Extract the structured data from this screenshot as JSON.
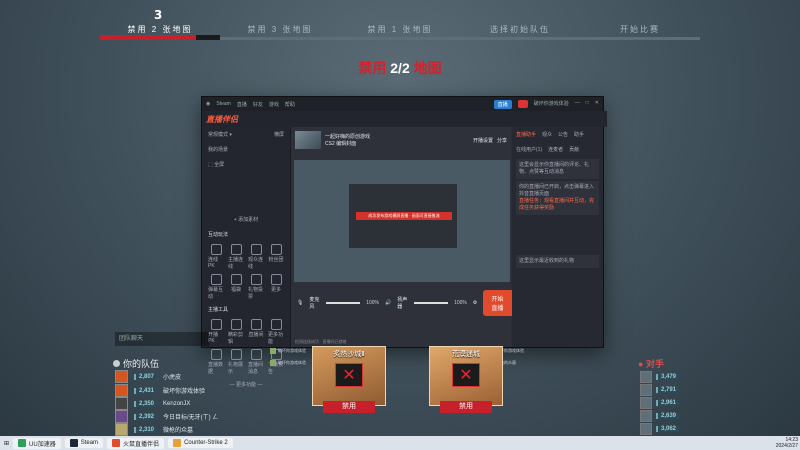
{
  "veto": {
    "steps": [
      "禁用 2 张地图",
      "禁用 3 张地图",
      "禁用 1 张地图",
      "选择初始队伍",
      "开始比赛"
    ],
    "active_index": 0,
    "current_step_number": "3",
    "ban_count_prefix": "禁用",
    "ban_count_value": "2/2",
    "ban_count_suffix": "地图"
  },
  "window": {
    "app_name": "Steam",
    "title_menu": [
      "直播",
      "好友",
      "游戏",
      "帮助"
    ],
    "live_button": "直播",
    "user_name": "破坏你游戏体验",
    "logo": "直播伴侣",
    "left_panel": {
      "scene_header": "常规模式",
      "scene_tab_1": "横屏",
      "scene_tab_2": "竖屏",
      "source_label": "我的场景",
      "source_item": "全屏",
      "add_source": "+ 添加素材",
      "interact_title": "互动玩法",
      "interact_items": [
        "连线PK",
        "主播连线",
        "观众连线",
        "粉丝团",
        "弹幕互动",
        "福袋",
        "礼物投票",
        "更多"
      ],
      "tools_title": "主播工具",
      "tool_items": [
        "开播PK",
        "精彩剪辑",
        "直播间",
        "更多功能",
        "直播数据",
        "礼物展示",
        "直播间消息",
        "下播预告"
      ],
      "more": "— 更多功能 —"
    },
    "stream": {
      "title": "一起好嗨的原创游戏",
      "tag": "CS2",
      "edit_label": "编辑封面",
      "live_count": "开播设置",
      "share_label": "分享"
    },
    "preview_toast": "成功发布游戏横屏直播 · 画面可直接推流",
    "volume": {
      "mic_label": "麦克风",
      "mic_pct": "100%",
      "speaker_label": "扬声器",
      "speaker_pct": "100%",
      "mute_label": "静音",
      "settings_label": "设置"
    },
    "start_button": "开始直播",
    "status_bar": "检测连接成功 · 直播间已就绪",
    "right_panel": {
      "tabs": [
        "直播助手",
        "观众",
        "公告",
        "助手"
      ],
      "sub_tabs": [
        "在线用户(1)",
        "连麦者",
        "贡献"
      ],
      "notice_1": "这里会显示你直播间的评论、礼物、点赞等互动消息",
      "notice_2": "你的直播间已开启，点击弹幕进入抖音直播页面",
      "notice_hl": "直播任务：观看直播间并互动，完成任务获得奖励",
      "footer": "这里显示最近收到的礼物"
    }
  },
  "chat_placeholder": "团队聊天",
  "your_team": {
    "title": "你的队伍",
    "players": [
      {
        "rank": "2,807",
        "name": "小虎皮"
      },
      {
        "rank": "2,431",
        "name": "破坏你游戏体验"
      },
      {
        "rank": "2,350",
        "name": "KenzonJX"
      },
      {
        "rank": "2,392",
        "name": "今日目标/无牙(ㄒ) ㄥ"
      },
      {
        "rank": "2,310",
        "name": "微枪的众墓"
      }
    ]
  },
  "enemy_team": {
    "title": "对手",
    "ranks": [
      "3,479",
      "2,791",
      "2,961",
      "2,639",
      "3,062"
    ]
  },
  "maps": [
    {
      "name": "炙热沙城Ⅱ",
      "status": "禁用",
      "picked_by": [
        "破坏你游戏体验",
        "破坏你游戏体验"
      ]
    },
    {
      "name": "荒漠迷城",
      "status": "禁用",
      "picked_by": [
        "破坏你游戏体验",
        "微枪的众墓"
      ]
    }
  ],
  "taskbar": {
    "items": [
      "UU加速器",
      "Steam",
      "火鼠直播伴侣",
      "Counter-Strike 2"
    ],
    "time": "14:23",
    "date": "2024/2/27"
  }
}
